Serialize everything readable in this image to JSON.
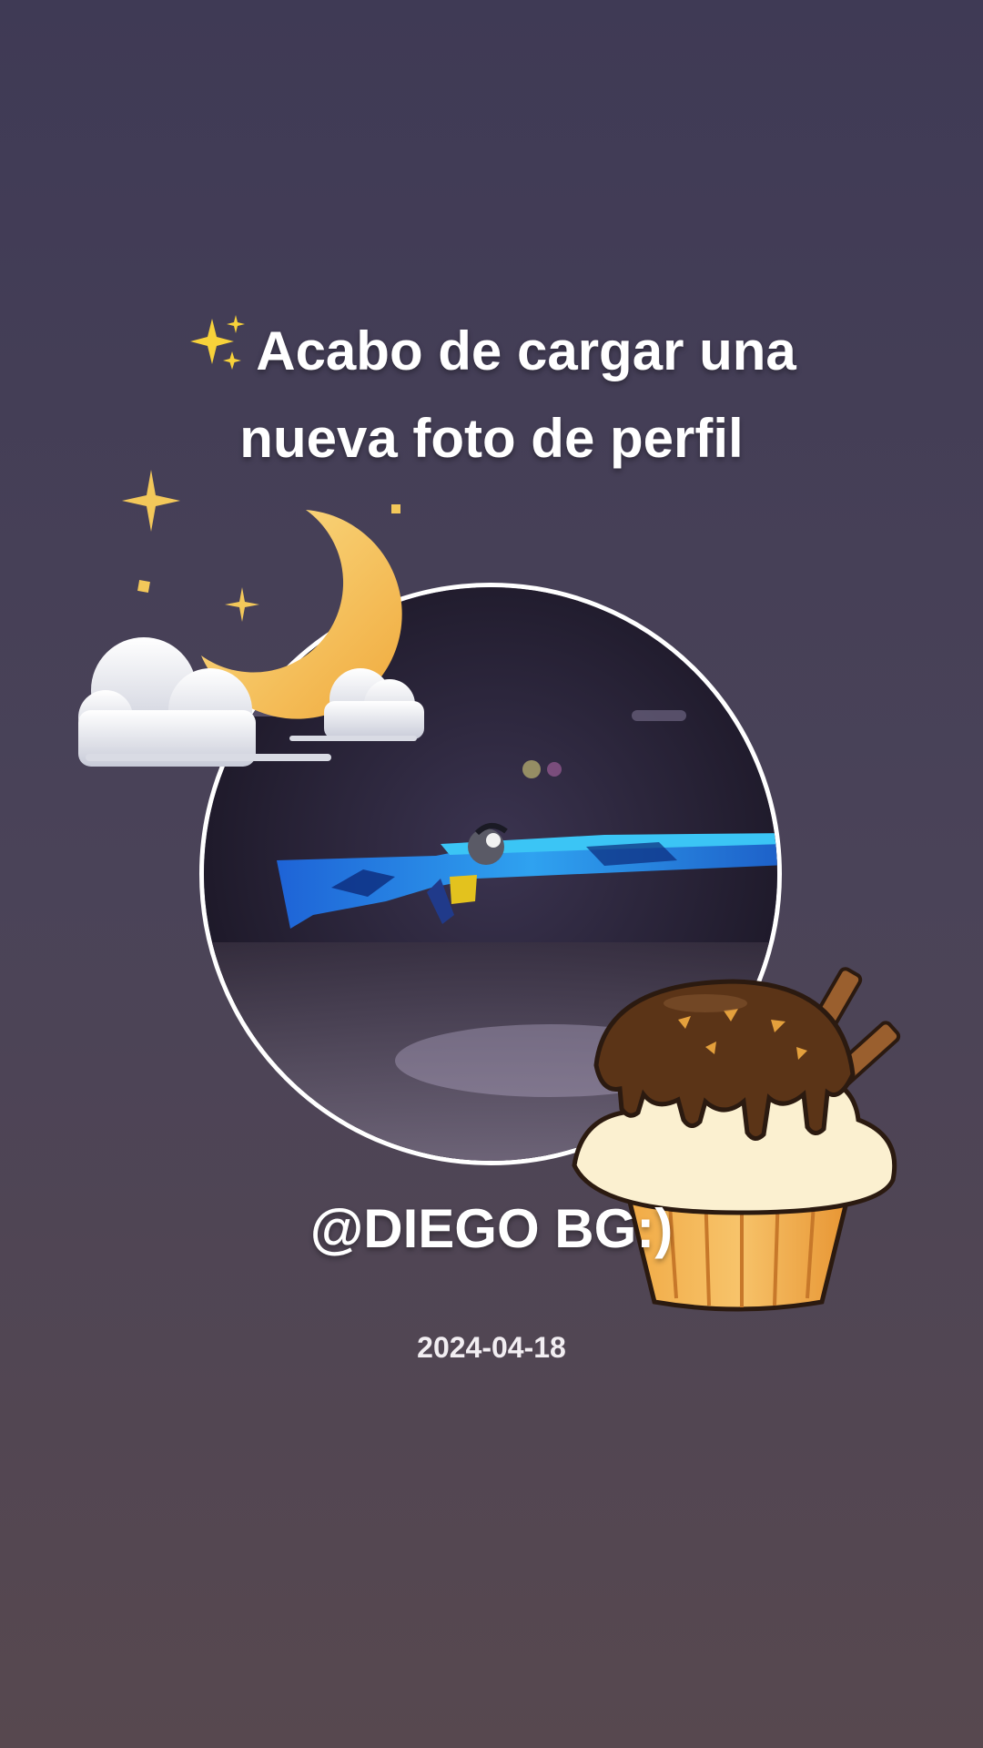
{
  "post": {
    "title_lines": [
      "Acabo de cargar una",
      "nueva foto de perfil"
    ],
    "sparkle_icon": "sparkles-icon",
    "username": "@DIEGO BG:)",
    "date": "2024-04-18"
  },
  "photo": {
    "icon": "profile-photo",
    "subject": "blue-camo-shotgun"
  },
  "stickers": [
    {
      "icon": "moon-clouds-sticker"
    },
    {
      "icon": "cupcake-sticker"
    }
  ],
  "colors": {
    "background_top": "#3f3a55",
    "background_bottom": "#57484f",
    "text": "#ffffff",
    "moon": "#f5c25a",
    "photo_border": "#ffffff"
  }
}
